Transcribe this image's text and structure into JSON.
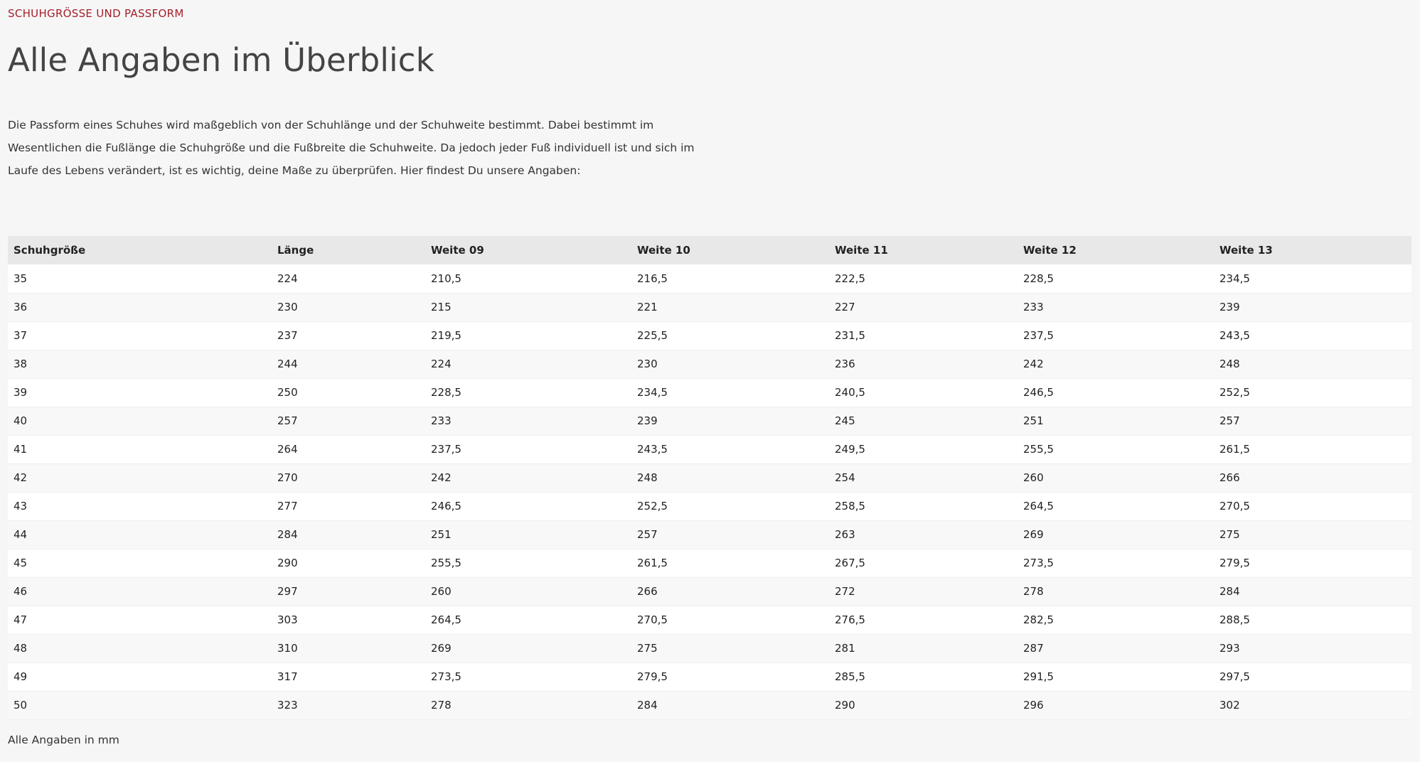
{
  "eyebrow": "SCHUHGRÖSSE UND PASSFORM",
  "title": "Alle Angaben im Überblick",
  "intro": "Die Passform eines Schuhes wird maßgeblich von der Schuhlänge und der Schuhweite bestimmt. Dabei bestimmt im Wesentlichen die Fußlänge die Schuhgröße und die Fußbreite die Schuhweite. Da jedoch jeder Fuß individuell ist und sich im Laufe des Lebens verändert, ist es wichtig, deine Maße zu überprüfen. Hier findest Du unsere Angaben:",
  "table": {
    "headers": [
      "Schuhgröße",
      "Länge",
      "Weite 09",
      "Weite 10",
      "Weite 11",
      "Weite 12",
      "Weite 13"
    ],
    "rows": [
      [
        "35",
        "224",
        "210,5",
        "216,5",
        "222,5",
        "228,5",
        "234,5"
      ],
      [
        "36",
        "230",
        "215",
        "221",
        "227",
        "233",
        "239"
      ],
      [
        "37",
        "237",
        "219,5",
        "225,5",
        "231,5",
        "237,5",
        "243,5"
      ],
      [
        "38",
        "244",
        "224",
        "230",
        "236",
        "242",
        "248"
      ],
      [
        "39",
        "250",
        "228,5",
        "234,5",
        "240,5",
        "246,5",
        "252,5"
      ],
      [
        "40",
        "257",
        "233",
        "239",
        "245",
        "251",
        "257"
      ],
      [
        "41",
        "264",
        "237,5",
        "243,5",
        "249,5",
        "255,5",
        "261,5"
      ],
      [
        "42",
        "270",
        "242",
        "248",
        "254",
        "260",
        "266"
      ],
      [
        "43",
        "277",
        "246,5",
        "252,5",
        "258,5",
        "264,5",
        "270,5"
      ],
      [
        "44",
        "284",
        "251",
        "257",
        "263",
        "269",
        "275"
      ],
      [
        "45",
        "290",
        "255,5",
        "261,5",
        "267,5",
        "273,5",
        "279,5"
      ],
      [
        "46",
        "297",
        "260",
        "266",
        "272",
        "278",
        "284"
      ],
      [
        "47",
        "303",
        "264,5",
        "270,5",
        "276,5",
        "282,5",
        "288,5"
      ],
      [
        "48",
        "310",
        "269",
        "275",
        "281",
        "287",
        "293"
      ],
      [
        "49",
        "317",
        "273,5",
        "279,5",
        "285,5",
        "291,5",
        "297,5"
      ],
      [
        "50",
        "323",
        "278",
        "284",
        "290",
        "296",
        "302"
      ]
    ]
  },
  "footnote": "Alle Angaben in mm",
  "colors": {
    "accent": "#a5202a",
    "header_bg": "#e8e8e8",
    "page_bg": "#f6f6f6"
  }
}
